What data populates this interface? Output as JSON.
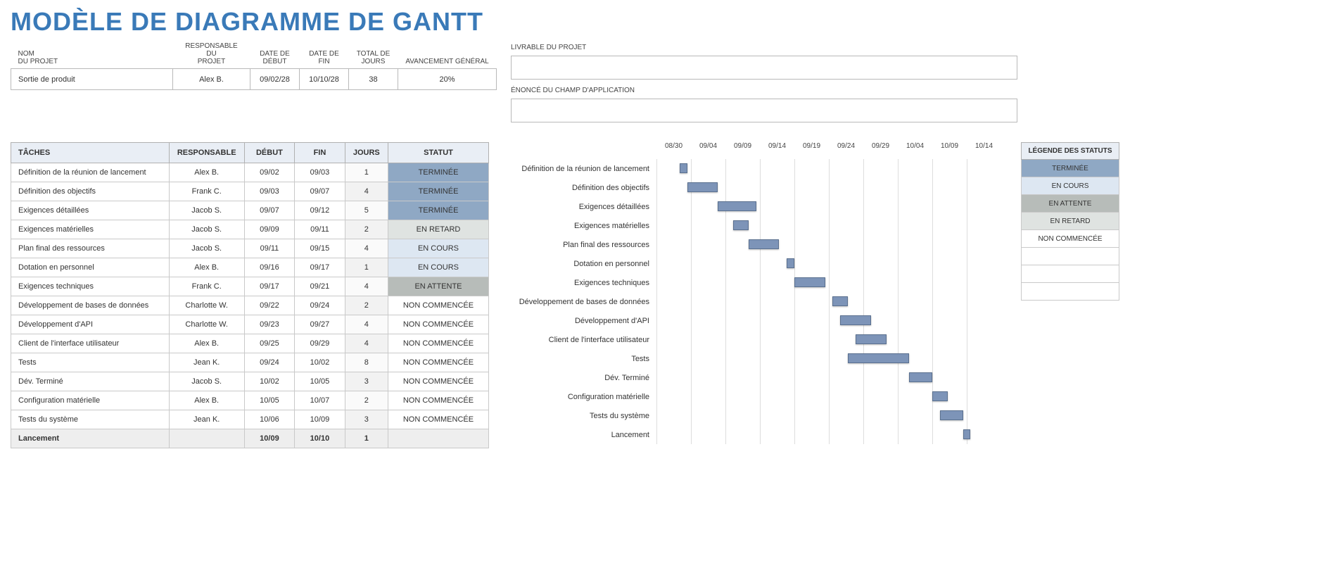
{
  "title": "MODÈLE DE DIAGRAMME DE GANTT",
  "summary": {
    "headers": {
      "nom": "NOM\nDU PROJET",
      "responsable": "RESPONSABLE DU\nPROJET",
      "debut": "DATE DE\nDÉBUT",
      "fin": "DATE DE\nFIN",
      "jours": "TOTAL DE\nJOURS",
      "avancement": "AVANCEMENT GÉNÉRAL"
    },
    "values": {
      "nom": "Sortie de produit",
      "responsable": "Alex B.",
      "debut": "09/02/28",
      "fin": "10/10/28",
      "jours": "38",
      "avancement": "20%"
    }
  },
  "right": {
    "livrable_label": "LIVRABLE DU PROJET",
    "livrable_value": "",
    "scope_label": "ÉNONCÉ DU CHAMP D'APPLICATION",
    "scope_value": ""
  },
  "task_headers": {
    "tache": "TÂCHES",
    "responsable": "RESPONSABLE",
    "debut": "DÉBUT",
    "fin": "FIN",
    "jours": "JOURS",
    "statut": "STATUT"
  },
  "tasks": [
    {
      "tache": "Définition de la réunion de lancement",
      "responsable": "Alex B.",
      "debut": "09/02",
      "fin": "09/03",
      "jours": "1",
      "statut": "TERMINÉE",
      "statusClass": "status-terminee",
      "bold": false
    },
    {
      "tache": "Définition des objectifs",
      "responsable": "Frank C.",
      "debut": "09/03",
      "fin": "09/07",
      "jours": "4",
      "statut": "TERMINÉE",
      "statusClass": "status-terminee",
      "bold": false
    },
    {
      "tache": "Exigences détaillées",
      "responsable": "Jacob S.",
      "debut": "09/07",
      "fin": "09/12",
      "jours": "5",
      "statut": "TERMINÉE",
      "statusClass": "status-terminee",
      "bold": false
    },
    {
      "tache": "Exigences matérielles",
      "responsable": "Jacob S.",
      "debut": "09/09",
      "fin": "09/11",
      "jours": "2",
      "statut": "EN RETARD",
      "statusClass": "status-enretard",
      "bold": false
    },
    {
      "tache": "Plan final des ressources",
      "responsable": "Jacob S.",
      "debut": "09/11",
      "fin": "09/15",
      "jours": "4",
      "statut": "EN COURS",
      "statusClass": "status-encours",
      "bold": false
    },
    {
      "tache": "Dotation en personnel",
      "responsable": "Alex B.",
      "debut": "09/16",
      "fin": "09/17",
      "jours": "1",
      "statut": "EN COURS",
      "statusClass": "status-encours",
      "bold": false
    },
    {
      "tache": "Exigences techniques",
      "responsable": "Frank C.",
      "debut": "09/17",
      "fin": "09/21",
      "jours": "4",
      "statut": "EN ATTENTE",
      "statusClass": "status-enattente",
      "bold": false
    },
    {
      "tache": "Développement de bases de données",
      "responsable": "Charlotte W.",
      "debut": "09/22",
      "fin": "09/24",
      "jours": "2",
      "statut": "NON COMMENCÉE",
      "statusClass": "status-noncommencee",
      "bold": false
    },
    {
      "tache": "Développement d'API",
      "responsable": "Charlotte W.",
      "debut": "09/23",
      "fin": "09/27",
      "jours": "4",
      "statut": "NON COMMENCÉE",
      "statusClass": "status-noncommencee",
      "bold": false
    },
    {
      "tache": "Client de l'interface utilisateur",
      "responsable": "Alex B.",
      "debut": "09/25",
      "fin": "09/29",
      "jours": "4",
      "statut": "NON COMMENCÉE",
      "statusClass": "status-noncommencee",
      "bold": false
    },
    {
      "tache": "Tests",
      "responsable": "Jean K.",
      "debut": "09/24",
      "fin": "10/02",
      "jours": "8",
      "statut": "NON COMMENCÉE",
      "statusClass": "status-noncommencee",
      "bold": false
    },
    {
      "tache": "Dév. Terminé",
      "responsable": "Jacob S.",
      "debut": "10/02",
      "fin": "10/05",
      "jours": "3",
      "statut": "NON COMMENCÉE",
      "statusClass": "status-noncommencee",
      "bold": false
    },
    {
      "tache": "Configuration matérielle",
      "responsable": "Alex B.",
      "debut": "10/05",
      "fin": "10/07",
      "jours": "2",
      "statut": "NON COMMENCÉE",
      "statusClass": "status-noncommencee",
      "bold": false
    },
    {
      "tache": "Tests du système",
      "responsable": "Jean K.",
      "debut": "10/06",
      "fin": "10/09",
      "jours": "3",
      "statut": "NON COMMENCÉE",
      "statusClass": "status-noncommencee",
      "bold": false
    },
    {
      "tache": "Lancement",
      "responsable": "",
      "debut": "10/09",
      "fin": "10/10",
      "jours": "1",
      "statut": "",
      "statusClass": "",
      "bold": true
    }
  ],
  "chart_data": {
    "type": "gantt",
    "title": "",
    "x_ticks": [
      "08/30",
      "09/04",
      "09/09",
      "09/14",
      "09/19",
      "09/24",
      "09/29",
      "10/04",
      "10/09",
      "10/14"
    ],
    "x_range_days": {
      "start": "08/30",
      "end": "10/14",
      "total": 45
    },
    "series": [
      {
        "name": "Définition de la réunion de lancement",
        "start_day": 3,
        "duration": 1
      },
      {
        "name": "Définition des objectifs",
        "start_day": 4,
        "duration": 4
      },
      {
        "name": "Exigences détaillées",
        "start_day": 8,
        "duration": 5
      },
      {
        "name": "Exigences matérielles",
        "start_day": 10,
        "duration": 2
      },
      {
        "name": "Plan final des ressources",
        "start_day": 12,
        "duration": 4
      },
      {
        "name": "Dotation en personnel",
        "start_day": 17,
        "duration": 1
      },
      {
        "name": "Exigences techniques",
        "start_day": 18,
        "duration": 4
      },
      {
        "name": "Développement de bases de données",
        "start_day": 23,
        "duration": 2
      },
      {
        "name": "Développement d'API",
        "start_day": 24,
        "duration": 4
      },
      {
        "name": "Client de l'interface utilisateur",
        "start_day": 26,
        "duration": 4
      },
      {
        "name": "Tests",
        "start_day": 25,
        "duration": 8
      },
      {
        "name": "Dév. Terminé",
        "start_day": 33,
        "duration": 3
      },
      {
        "name": "Configuration matérielle",
        "start_day": 36,
        "duration": 2
      },
      {
        "name": "Tests du système",
        "start_day": 37,
        "duration": 3
      },
      {
        "name": "Lancement",
        "start_day": 40,
        "duration": 1
      }
    ]
  },
  "legend": {
    "header": "LÉGENDE DES STATUTS",
    "items": [
      {
        "label": "TERMINÉE",
        "class": "status-terminee"
      },
      {
        "label": "EN COURS",
        "class": "status-encours"
      },
      {
        "label": "EN ATTENTE",
        "class": "status-enattente"
      },
      {
        "label": "EN RETARD",
        "class": "status-enretard"
      },
      {
        "label": "NON COMMENCÉE",
        "class": "status-noncommencee"
      },
      {
        "label": "",
        "class": ""
      },
      {
        "label": "",
        "class": ""
      },
      {
        "label": "",
        "class": ""
      }
    ]
  }
}
